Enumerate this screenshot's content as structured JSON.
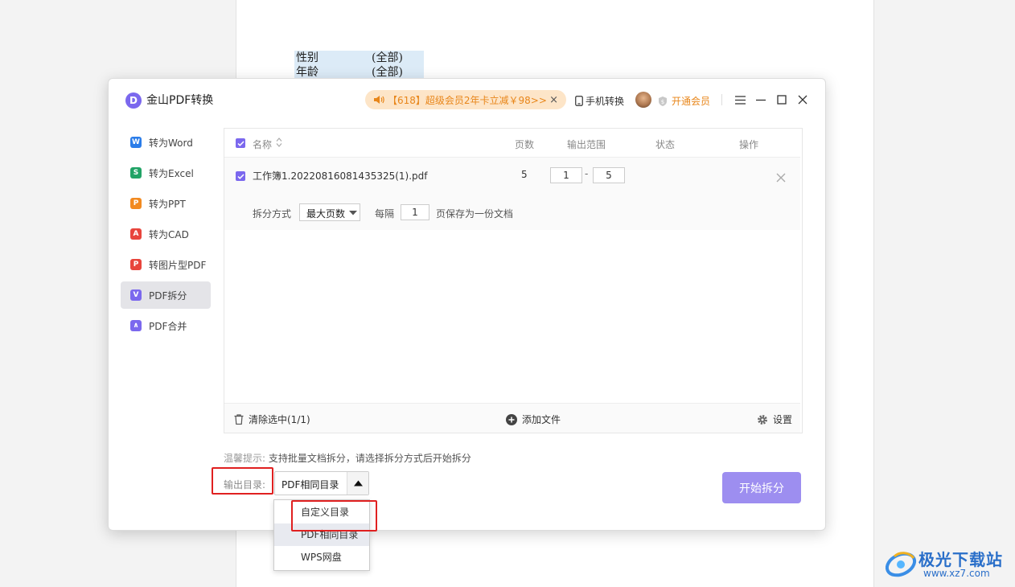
{
  "document": {
    "rows": [
      {
        "field": "性别",
        "value": "(全部)"
      },
      {
        "field": "年龄",
        "value": "(全部)"
      }
    ]
  },
  "app": {
    "logo_letter": "D",
    "title": "金山PDF转换",
    "promo": "【618】超级会员2年卡立减￥98>>",
    "promo_close": "×",
    "phone_convert": "手机转换",
    "vip": "开通会员",
    "accent_color": "#7b68ee",
    "vip_color": "#e8861a"
  },
  "sidebar": {
    "items": [
      {
        "label": "转为Word",
        "icon": "word-icon",
        "glyph": "W",
        "color": "#2b7de9"
      },
      {
        "label": "转为Excel",
        "icon": "excel-icon",
        "glyph": "S",
        "color": "#21a366"
      },
      {
        "label": "转为PPT",
        "icon": "ppt-icon",
        "glyph": "P",
        "color": "#f28a20"
      },
      {
        "label": "转为CAD",
        "icon": "cad-icon",
        "glyph": "A",
        "color": "#e8453c"
      },
      {
        "label": "转图片型PDF",
        "icon": "image-pdf-icon",
        "glyph": "P",
        "color": "#e8453c"
      },
      {
        "label": "PDF拆分",
        "icon": "split-icon",
        "glyph": "V",
        "color": "#7b68ee",
        "active": true
      },
      {
        "label": "PDF合并",
        "icon": "merge-icon",
        "glyph": "∧",
        "color": "#7b68ee"
      }
    ]
  },
  "table": {
    "headers": {
      "name": "名称",
      "pages": "页数",
      "range": "输出范围",
      "status": "状态",
      "action": "操作"
    },
    "file": {
      "name": "工作簿1.20220816081435325(1).pdf",
      "pages": "5",
      "range_from": "1",
      "range_sep": "-",
      "range_to": "5",
      "status": ""
    },
    "split": {
      "label": "拆分方式",
      "mode": "最大页数",
      "every_label": "每隔",
      "every_value": "1",
      "suffix": "页保存为一份文档"
    },
    "footer": {
      "clear": "清除选中(1/1)",
      "add": "添加文件",
      "settings": "设置"
    }
  },
  "tip": {
    "label": "温馨提示:",
    "text": "支持批量文档拆分，请选择拆分方式后开始拆分"
  },
  "output": {
    "label": "输出目录:",
    "selected": "PDF相同目录",
    "options": [
      "自定义目录",
      "PDF相同目录",
      "WPS网盘"
    ]
  },
  "start_button": "开始拆分",
  "watermark": {
    "brand": "极光下载站",
    "url": "www.xz7.com"
  }
}
